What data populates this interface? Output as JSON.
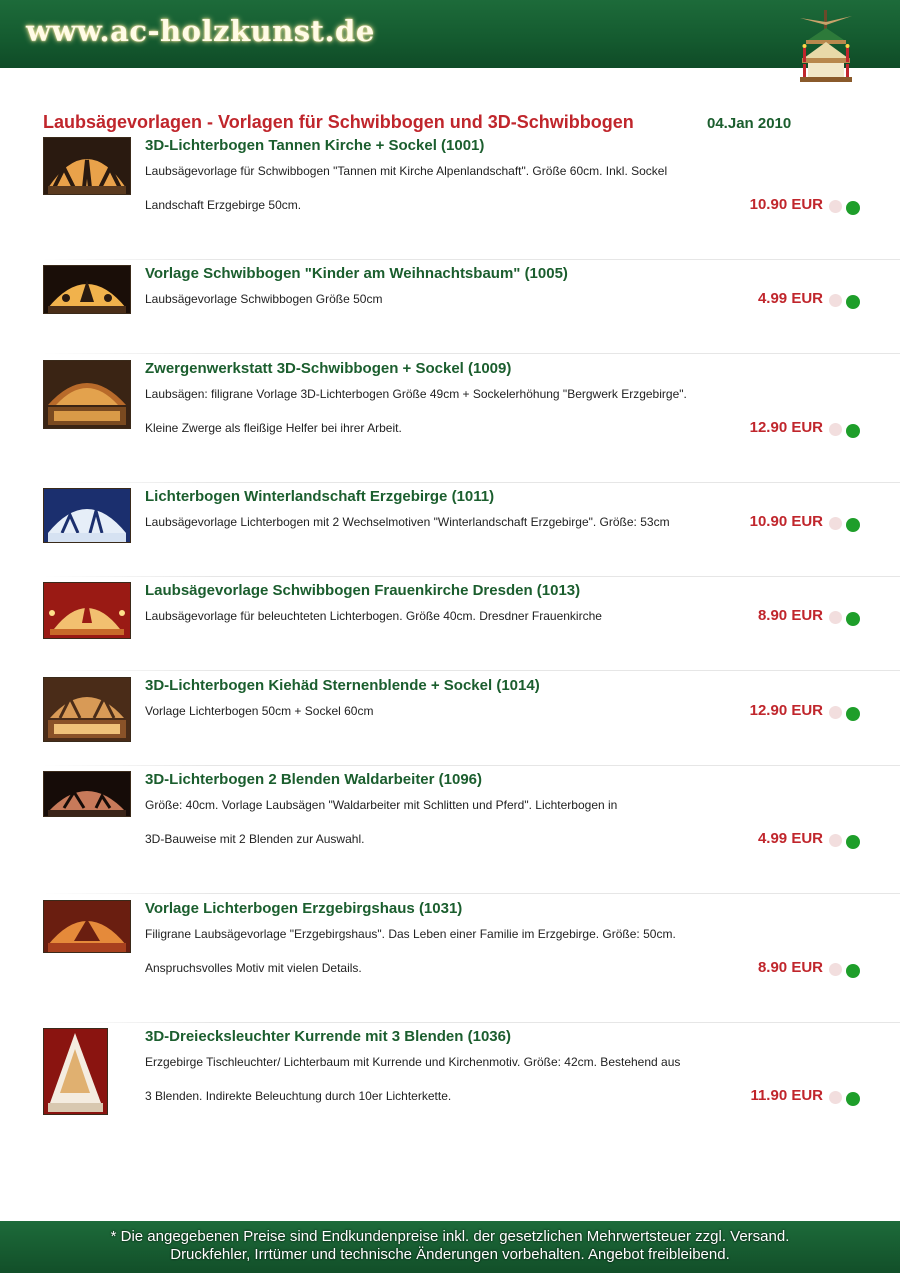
{
  "header": {
    "site_title": "www.ac-holzkunst.de"
  },
  "page": {
    "heading": "Laubsägevorlagen - Vorlagen für Schwibbogen und 3D-Schwibbogen",
    "date": "04.Jan 2010"
  },
  "products": [
    {
      "title": "3D-Lichterbogen Tannen Kirche + Sockel (1001)",
      "desc1": "Laubsägevorlage für Schwibbogen \"Tannen mit Kirche Alpenlandschaft\". Größe 60cm. Inkl. Sockel",
      "desc2": "Landschaft Erzgebirge 50cm.",
      "price": "10.90 EUR"
    },
    {
      "title": "Vorlage Schwibbogen \"Kinder am Weihnachtsbaum\" (1005)",
      "desc1": "Laubsägevorlage Schwibbogen Größe 50cm",
      "desc2": "",
      "price": "4.99 EUR"
    },
    {
      "title": "Zwergenwerkstatt 3D-Schwibbogen + Sockel (1009)",
      "desc1": "Laubsägen: filigrane Vorlage 3D-Lichterbogen Größe 49cm + Sockelerhöhung \"Bergwerk Erzgebirge\".",
      "desc2": "Kleine Zwerge als fleißige Helfer bei ihrer Arbeit.",
      "price": "12.90 EUR"
    },
    {
      "title": "Lichterbogen Winterlandschaft Erzgebirge (1011)",
      "desc1": "Laubsägevorlage Lichterbogen mit 2 Wechselmotiven \"Winterlandschaft Erzgebirge\". Größe: 53cm",
      "desc2": "",
      "price": "10.90 EUR"
    },
    {
      "title": "Laubsägevorlage Schwibbogen Frauenkirche Dresden (1013)",
      "desc1": "Laubsägevorlage für beleuchteten Lichterbogen. Größe 40cm. Dresdner Frauenkirche",
      "desc2": "",
      "price": "8.90 EUR"
    },
    {
      "title": "3D-Lichterbogen Kiehäd Sternenblende + Sockel (1014)",
      "desc1": "Vorlage Lichterbogen 50cm + Sockel 60cm",
      "desc2": "",
      "price": "12.90 EUR"
    },
    {
      "title": "3D-Lichterbogen 2 Blenden Waldarbeiter (1096)",
      "desc1": "Größe: 40cm. Vorlage Laubsägen \"Waldarbeiter mit Schlitten und Pferd\". Lichterbogen in",
      "desc2": "3D-Bauweise mit 2 Blenden zur Auswahl.",
      "price": "4.99 EUR"
    },
    {
      "title": "Vorlage Lichterbogen Erzgebirgshaus (1031)",
      "desc1": "Filigrane Laubsägevorlage \"Erzgebirgshaus\". Das Leben einer Familie im Erzgebirge. Größe: 50cm.",
      "desc2": "Anspruchsvolles Motiv mit vielen Details.",
      "price": "8.90 EUR"
    },
    {
      "title": "3D-Dreiecksleuchter Kurrende mit 3 Blenden (1036)",
      "desc1": "Erzgebirge Tischleuchter/ Lichterbaum mit Kurrende und Kirchenmotiv. Größe: 42cm. Bestehend aus",
      "desc2": "3 Blenden. Indirekte Beleuchtung durch 10er Lichterkette.",
      "price": "11.90 EUR"
    }
  ],
  "footer": {
    "line1": "* Die angegebenen Preise sind Endkundenpreise inkl. der gesetzlichen Mehrwertsteuer zzgl. Versand.",
    "line2": "Druckfehler, Irrtümer und technische Änderungen vorbehalten. Angebot freibleibend."
  },
  "colors": {
    "brand_green": "#145a2f",
    "title_green": "#1b5e2e",
    "price_red": "#c0262c",
    "dot_green": "#1e9e2a",
    "dot_pink": "#f2dede"
  }
}
